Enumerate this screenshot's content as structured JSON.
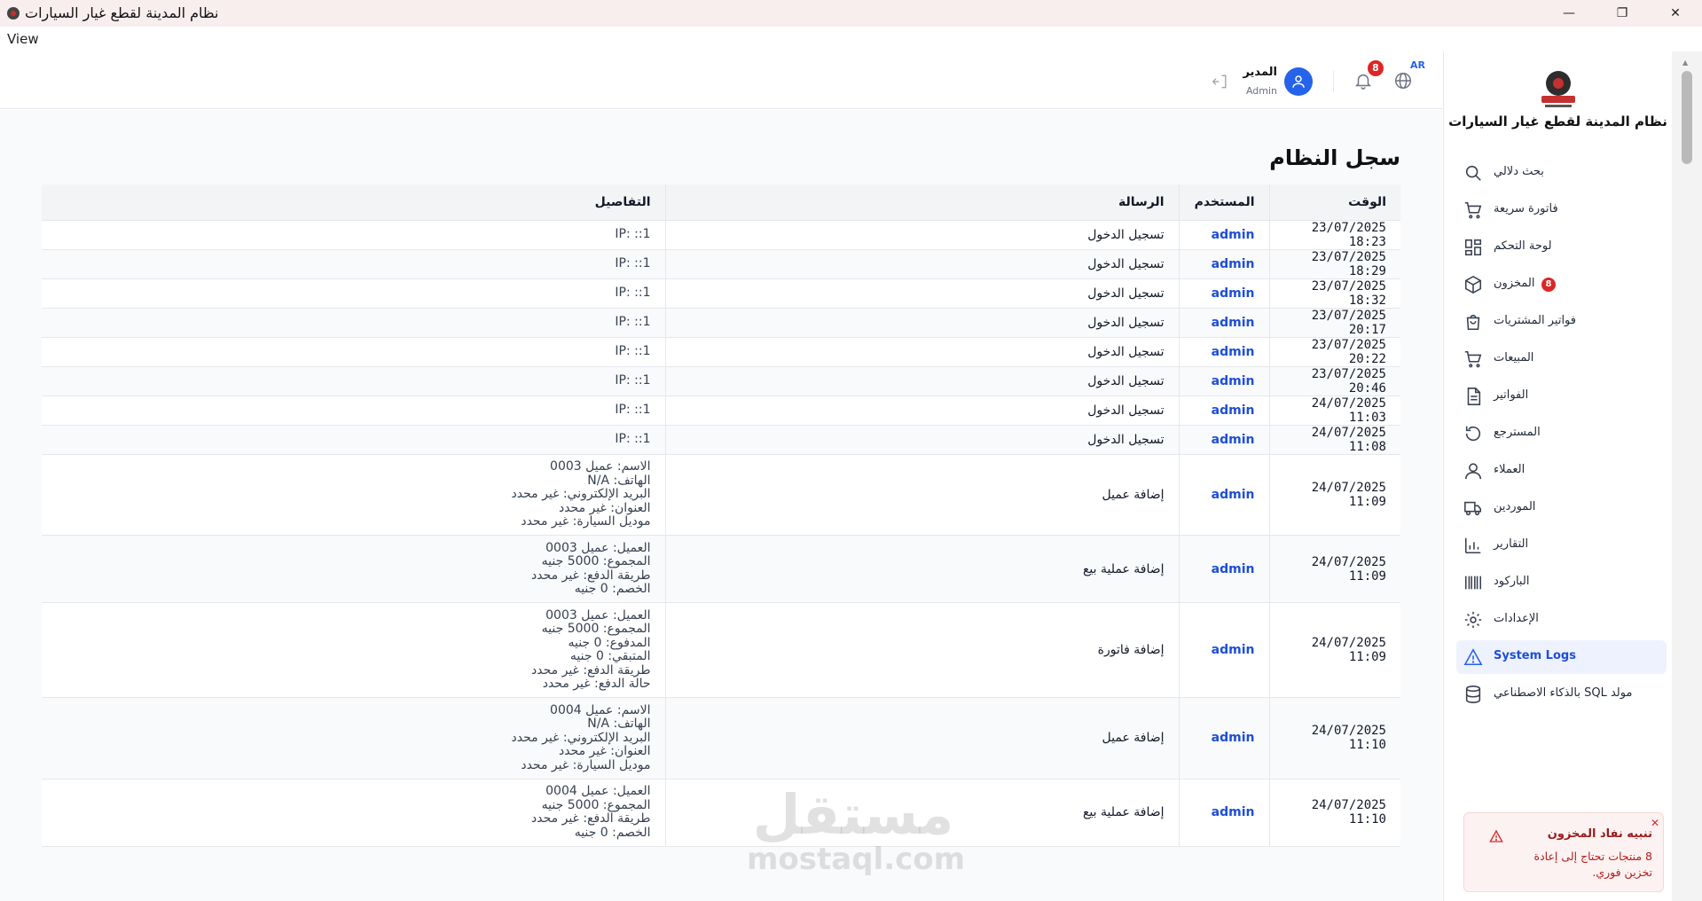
{
  "window": {
    "title": "نظام المدينة لقطع غيار السيارات",
    "menu_view": "View",
    "minimize_glyph": "—",
    "maximize_glyph": "❐",
    "close_glyph": "✕"
  },
  "header": {
    "lang_code": "AR",
    "notif_count": "8",
    "user_name": "المدير",
    "user_role": "Admin"
  },
  "sidebar": {
    "brand": "نظام المدينة لقطع غيار السيارات",
    "items": [
      {
        "label": "بحث دلالي",
        "icon": "search-icon"
      },
      {
        "label": "فاتورة سريعة",
        "icon": "cart-icon"
      },
      {
        "label": "لوحة التحكم",
        "icon": "dashboard-icon"
      },
      {
        "label": "المخزون",
        "icon": "box-icon",
        "badge": "8"
      },
      {
        "label": "فواتير المشتريات",
        "icon": "shopping-bag-icon"
      },
      {
        "label": "المبيعات",
        "icon": "cart-icon"
      },
      {
        "label": "الفواتير",
        "icon": "document-icon"
      },
      {
        "label": "المسترجع",
        "icon": "undo-icon"
      },
      {
        "label": "العملاء",
        "icon": "user-icon"
      },
      {
        "label": "الموردين",
        "icon": "truck-icon"
      },
      {
        "label": "التقارير",
        "icon": "bar-chart-icon"
      },
      {
        "label": "الباركود",
        "icon": "barcode-icon"
      },
      {
        "label": "الإعدادات",
        "icon": "gear-icon"
      },
      {
        "label": "System Logs",
        "icon": "warning-icon",
        "active": true
      },
      {
        "label": "مولد SQL بالذكاء الاصطناعي",
        "icon": "database-icon"
      }
    ]
  },
  "main": {
    "page_title": "سجل النظام",
    "columns": [
      "الوقت",
      "المستخدم",
      "الرسالة",
      "التفاصيل"
    ],
    "rows": [
      {
        "time": "23/07/2025 18:23",
        "user": "admin",
        "message": "تسجيل الدخول",
        "details": "IP: ::1"
      },
      {
        "time": "23/07/2025 18:29",
        "user": "admin",
        "message": "تسجيل الدخول",
        "details": "IP: ::1"
      },
      {
        "time": "23/07/2025 18:32",
        "user": "admin",
        "message": "تسجيل الدخول",
        "details": "IP: ::1"
      },
      {
        "time": "23/07/2025 20:17",
        "user": "admin",
        "message": "تسجيل الدخول",
        "details": "IP: ::1"
      },
      {
        "time": "23/07/2025 20:22",
        "user": "admin",
        "message": "تسجيل الدخول",
        "details": "IP: ::1"
      },
      {
        "time": "23/07/2025 20:46",
        "user": "admin",
        "message": "تسجيل الدخول",
        "details": "IP: ::1"
      },
      {
        "time": "24/07/2025 11:03",
        "user": "admin",
        "message": "تسجيل الدخول",
        "details": "IP: ::1"
      },
      {
        "time": "24/07/2025 11:08",
        "user": "admin",
        "message": "تسجيل الدخول",
        "details": "IP: ::1"
      },
      {
        "time": "24/07/2025 11:09",
        "user": "admin",
        "message": "إضافة عميل",
        "details": "الاسم: عميل 0003\nالهاتف: N/A\nالبريد الإلكتروني: غير محدد\nالعنوان: غير محدد\nموديل السيارة: غير محدد"
      },
      {
        "time": "24/07/2025 11:09",
        "user": "admin",
        "message": "إضافة عملية بيع",
        "details": "العميل: عميل 0003\nالمجموع: 5000 جنيه\nطريقة الدفع: غير محدد\nالخصم: 0 جنيه"
      },
      {
        "time": "24/07/2025 11:09",
        "user": "admin",
        "message": "إضافة فاتورة",
        "details": "العميل: عميل 0003\nالمجموع: 5000 جنيه\nالمدفوع: 0 جنيه\nالمتبقي: 0 جنيه\nطريقة الدفع: غير محدد\nحالة الدفع: غير محدد"
      },
      {
        "time": "24/07/2025 11:10",
        "user": "admin",
        "message": "إضافة عميل",
        "details": "الاسم: عميل 0004\nالهاتف: N/A\nالبريد الإلكتروني: غير محدد\nالعنوان: غير محدد\nموديل السيارة: غير محدد"
      },
      {
        "time": "24/07/2025 11:10",
        "user": "admin",
        "message": "إضافة عملية بيع",
        "details": "العميل: عميل 0004\nالمجموع: 5000 جنيه\nطريقة الدفع: غير محدد\nالخصم: 0 جنيه"
      }
    ]
  },
  "toast": {
    "title": "تنبيه نفاد المخزون",
    "body": "8 منتجات تحتاج إلى إعادة تخزين فوري.",
    "close_glyph": "✕"
  },
  "watermark": {
    "arabic": "مستقل",
    "latin": "mostaql.com"
  },
  "colors": {
    "accent": "#2563eb",
    "danger": "#dc2626",
    "active_bg": "#eef2ff"
  }
}
